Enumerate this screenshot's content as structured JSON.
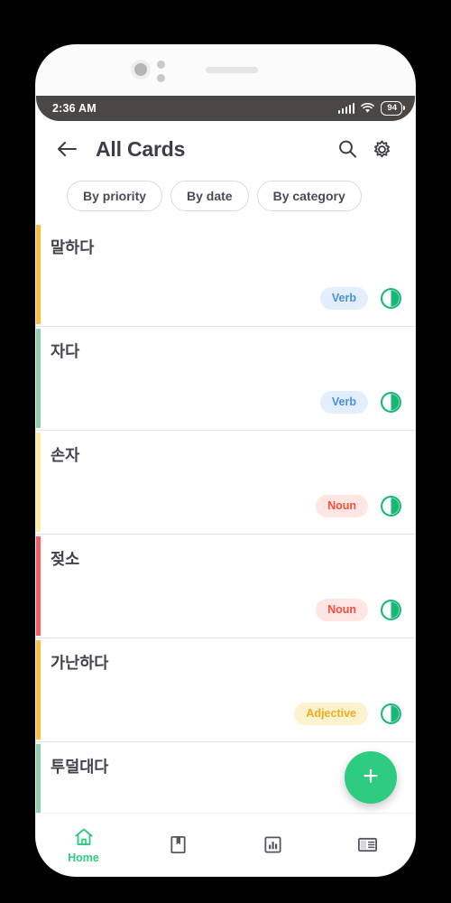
{
  "device": {
    "status_bar": {
      "time": "2:36 AM",
      "battery_level": "94",
      "signal_icon": "signal-bars-icon",
      "wifi_icon": "wifi-icon",
      "battery_icon": "battery-icon"
    }
  },
  "app_bar": {
    "back_icon": "back-arrow-icon",
    "title": "All Cards",
    "search_icon": "search-icon",
    "settings_icon": "gear-icon"
  },
  "filters": {
    "chips": [
      {
        "label": "By priority",
        "selected": false
      },
      {
        "label": "By date",
        "selected": false
      },
      {
        "label": "By category",
        "selected": false
      }
    ]
  },
  "theme": {
    "accent_green": "#2ecc80",
    "noun_badge_bg": "#ffe6e3",
    "noun_badge_fg": "#f4503c",
    "verb_badge_bg": "#e2eefb",
    "verb_badge_fg": "#4a8fd8",
    "adjective_badge_bg": "#fdf2d0",
    "adjective_badge_fg": "#efad1b",
    "status_bar_bg": "#4a4745",
    "title_color": "#3d3d47"
  },
  "cards": [
    {
      "word": "말하다",
      "part_of_speech": "Verb",
      "accent_color": "#fbbd40",
      "badge_bg": "#e2eefb",
      "badge_fg": "#4a8fd8",
      "progress_icon": "half-filled-circle-icon"
    },
    {
      "word": "자다",
      "part_of_speech": "Verb",
      "accent_color": "#8fcfae",
      "badge_bg": "#e2eefb",
      "badge_fg": "#4a8fd8",
      "progress_icon": "half-filled-circle-icon"
    },
    {
      "word": "손자",
      "part_of_speech": "Noun",
      "accent_color": "#fbeea0",
      "badge_bg": "#ffe6e3",
      "badge_fg": "#f4503c",
      "progress_icon": "half-filled-circle-icon"
    },
    {
      "word": "젖소",
      "part_of_speech": "Noun",
      "accent_color": "#f65e63",
      "badge_bg": "#ffe6e3",
      "badge_fg": "#f4503c",
      "progress_icon": "half-filled-circle-icon"
    },
    {
      "word": "가난하다",
      "part_of_speech": "Adjective",
      "accent_color": "#fbbd40",
      "badge_bg": "#fdf2d0",
      "badge_fg": "#efad1b",
      "progress_icon": "half-filled-circle-icon"
    },
    {
      "word": "투덜대다",
      "part_of_speech": "",
      "accent_color": "#8fcfae",
      "badge_bg": "",
      "badge_fg": "",
      "progress_icon": ""
    }
  ],
  "fab": {
    "icon": "plus-icon",
    "label": "+"
  },
  "bottom_nav": {
    "items": [
      {
        "label": "Home",
        "icon": "home-icon",
        "active": true
      },
      {
        "label": "",
        "icon": "bookmark-book-icon",
        "active": false
      },
      {
        "label": "",
        "icon": "bar-chart-icon",
        "active": false
      },
      {
        "label": "",
        "icon": "book-layout-icon",
        "active": false
      }
    ]
  }
}
